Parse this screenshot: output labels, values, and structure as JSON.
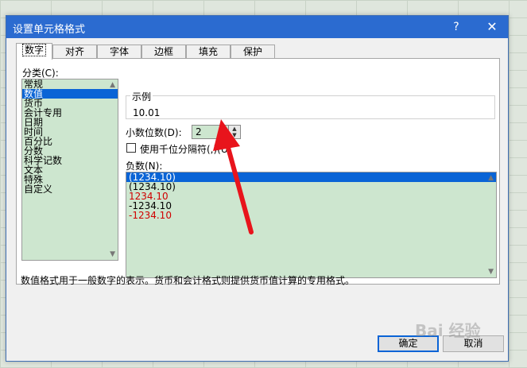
{
  "dialog": {
    "title": "设置单元格格式",
    "help_glyph": "?",
    "close_glyph": "✕"
  },
  "tabs": [
    "数字",
    "对齐",
    "字体",
    "边框",
    "填充",
    "保护"
  ],
  "category": {
    "label": "分类(C):",
    "items": [
      "常规",
      "数值",
      "货币",
      "会计专用",
      "日期",
      "时间",
      "百分比",
      "分数",
      "科学记数",
      "文本",
      "特殊",
      "自定义"
    ],
    "selected_index": 1
  },
  "sample": {
    "legend": "示例",
    "value": "10.01"
  },
  "decimal": {
    "label": "小数位数(D):",
    "value": "2"
  },
  "thousands": {
    "label": "使用千位分隔符(,)(U)"
  },
  "negative": {
    "label": "负数(N):",
    "items": [
      {
        "text": "(1234.10)",
        "color": "#ffffff"
      },
      {
        "text": "(1234.10)",
        "color": "#000000"
      },
      {
        "text": "1234.10",
        "color": "#d00000"
      },
      {
        "text": "-1234.10",
        "color": "#000000"
      },
      {
        "text": "-1234.10",
        "color": "#d00000"
      }
    ]
  },
  "description": "数值格式用于一般数字的表示。货币和会计格式则提供货币值计算的专用格式。",
  "buttons": {
    "ok": "确定",
    "cancel": "取消"
  },
  "watermark": "Bai 经验",
  "colors": {
    "titlebar": "#2b6bd0",
    "list_bg": "#cde6cf",
    "selection": "#0a64d6",
    "arrow": "#e8141c"
  }
}
